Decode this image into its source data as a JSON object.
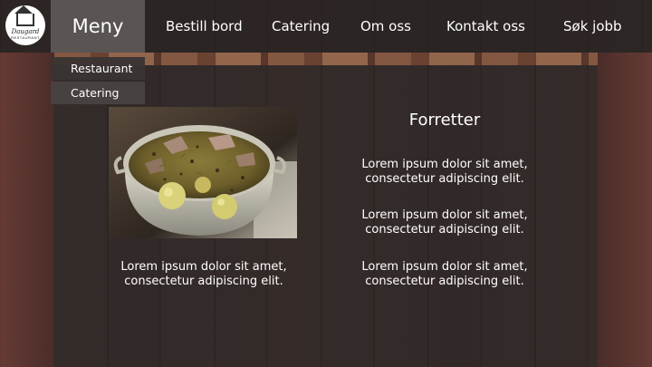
{
  "logo": {
    "name": "Daugard",
    "subtitle": "RESTAURANT"
  },
  "nav": {
    "menu_label": "Meny",
    "links": [
      {
        "label": "Bestill bord"
      },
      {
        "label": "Catering"
      },
      {
        "label": "Om oss"
      },
      {
        "label": "Kontakt oss"
      },
      {
        "label": "Søk jobb"
      }
    ]
  },
  "dropdown": {
    "items": [
      {
        "label": "Restaurant"
      },
      {
        "label": "Catering"
      }
    ],
    "selected": "Catering"
  },
  "main": {
    "image_caption": "Lorem ipsum dolor sit amet, consectetur adipiscing elit.",
    "section_title": "Forretter",
    "items": [
      {
        "text": "Lorem ipsum dolor sit amet, consectetur adipiscing elit."
      },
      {
        "text": "Lorem ipsum dolor sit amet, consectetur adipiscing elit."
      },
      {
        "text": "Lorem ipsum dolor sit amet, consectetur adipiscing elit."
      }
    ]
  },
  "colors": {
    "nav_background": "#282221",
    "menu_button": "#5a5553",
    "text": "#ffffff"
  },
  "image": {
    "subject": "soup-pot-photo"
  }
}
